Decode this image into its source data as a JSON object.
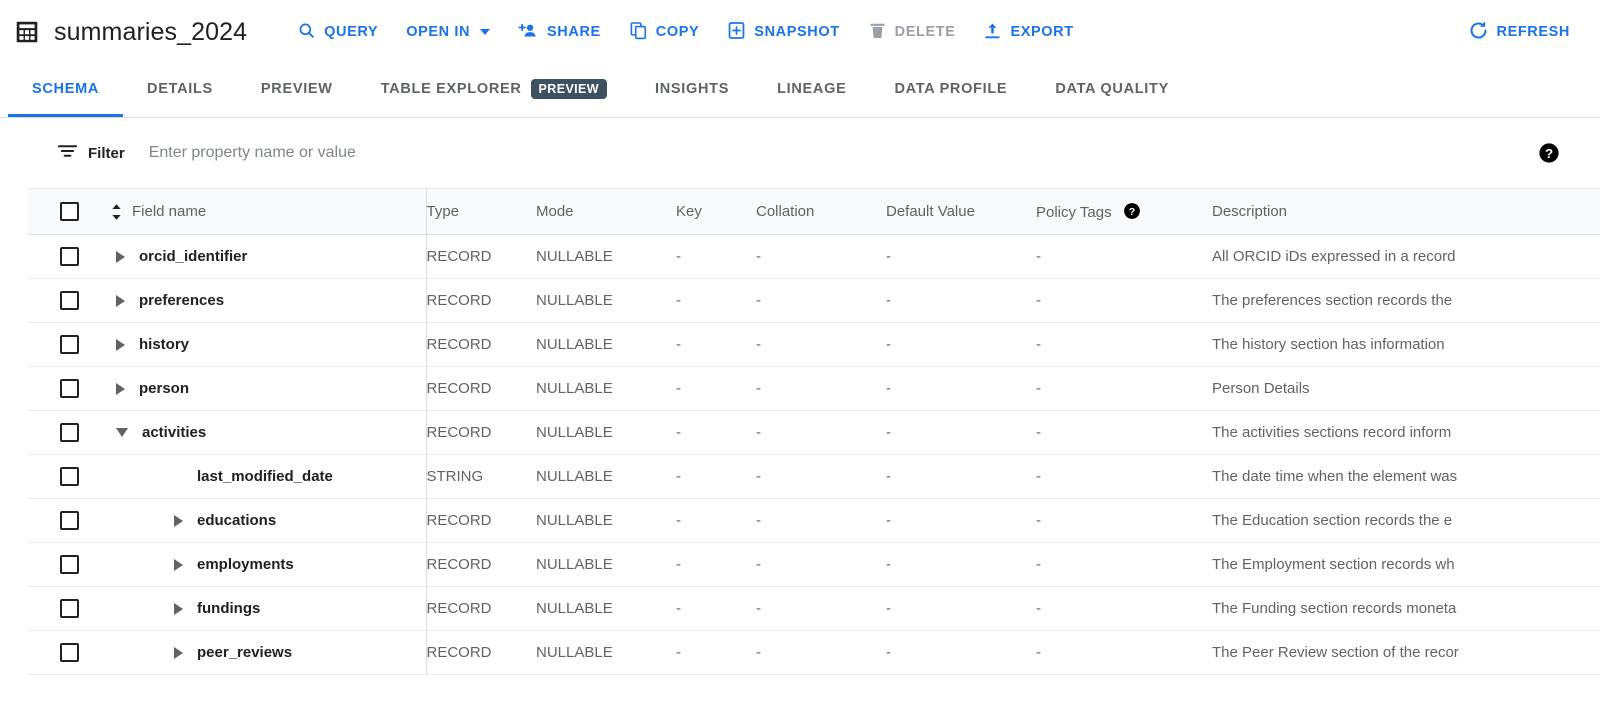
{
  "toolbar": {
    "table_icon": "table-grid-icon",
    "title": "summaries_2024",
    "actions": [
      {
        "label": "QUERY",
        "icon": "search-icon",
        "disabled": false,
        "dropdown": false
      },
      {
        "label": "OPEN IN",
        "icon": "none",
        "disabled": false,
        "dropdown": true
      },
      {
        "label": "SHARE",
        "icon": "person-add-icon",
        "disabled": false,
        "dropdown": false
      },
      {
        "label": "COPY",
        "icon": "copy-icon",
        "disabled": false,
        "dropdown": false
      },
      {
        "label": "SNAPSHOT",
        "icon": "snapshot-icon",
        "disabled": false,
        "dropdown": false
      },
      {
        "label": "DELETE",
        "icon": "trash-icon",
        "disabled": true,
        "dropdown": false
      },
      {
        "label": "EXPORT",
        "icon": "export-icon",
        "disabled": false,
        "dropdown": false
      }
    ],
    "refresh": {
      "label": "REFRESH",
      "icon": "refresh-icon"
    }
  },
  "tabs": [
    {
      "label": "SCHEMA",
      "active": true,
      "badge": ""
    },
    {
      "label": "DETAILS",
      "active": false,
      "badge": ""
    },
    {
      "label": "PREVIEW",
      "active": false,
      "badge": ""
    },
    {
      "label": "TABLE EXPLORER",
      "active": false,
      "badge": "PREVIEW"
    },
    {
      "label": "INSIGHTS",
      "active": false,
      "badge": ""
    },
    {
      "label": "LINEAGE",
      "active": false,
      "badge": ""
    },
    {
      "label": "DATA PROFILE",
      "active": false,
      "badge": ""
    },
    {
      "label": "DATA QUALITY",
      "active": false,
      "badge": ""
    }
  ],
  "filter": {
    "label": "Filter",
    "icon": "filter-icon",
    "value": "",
    "placeholder": "Enter property name or value",
    "help_icon": "help-circle-icon"
  },
  "table": {
    "columns": [
      "Field name",
      "Type",
      "Mode",
      "Key",
      "Collation",
      "Default Value",
      "Policy Tags",
      "Description"
    ],
    "policy_tags_help_icon": "help-circle-icon",
    "sort_icon": "sort-updown-icon",
    "select_all_checkbox": false,
    "rows": [
      {
        "name": "orcid_identifier",
        "indent": 0,
        "expander": "closed",
        "checked": false,
        "type": "RECORD",
        "mode": "NULLABLE",
        "key": "-",
        "collation": "-",
        "default_value": "-",
        "policy_tags": "-",
        "description": "All ORCID iDs expressed in a record"
      },
      {
        "name": "preferences",
        "indent": 0,
        "expander": "closed",
        "checked": false,
        "type": "RECORD",
        "mode": "NULLABLE",
        "key": "-",
        "collation": "-",
        "default_value": "-",
        "policy_tags": "-",
        "description": "The preferences section records the"
      },
      {
        "name": "history",
        "indent": 0,
        "expander": "closed",
        "checked": false,
        "type": "RECORD",
        "mode": "NULLABLE",
        "key": "-",
        "collation": "-",
        "default_value": "-",
        "policy_tags": "-",
        "description": "The history section has information"
      },
      {
        "name": "person",
        "indent": 0,
        "expander": "closed",
        "checked": false,
        "type": "RECORD",
        "mode": "NULLABLE",
        "key": "-",
        "collation": "-",
        "default_value": "-",
        "policy_tags": "-",
        "description": "Person Details"
      },
      {
        "name": "activities",
        "indent": 0,
        "expander": "open",
        "checked": false,
        "type": "RECORD",
        "mode": "NULLABLE",
        "key": "-",
        "collation": "-",
        "default_value": "-",
        "policy_tags": "-",
        "description": "The activities sections record inform"
      },
      {
        "name": "last_modified_date",
        "indent": 1,
        "expander": "none",
        "checked": false,
        "type": "STRING",
        "mode": "NULLABLE",
        "key": "-",
        "collation": "-",
        "default_value": "-",
        "policy_tags": "-",
        "description": "The date time when the element was"
      },
      {
        "name": "educations",
        "indent": 1,
        "expander": "closed",
        "checked": false,
        "type": "RECORD",
        "mode": "NULLABLE",
        "key": "-",
        "collation": "-",
        "default_value": "-",
        "policy_tags": "-",
        "description": "The Education section records the e"
      },
      {
        "name": "employments",
        "indent": 1,
        "expander": "closed",
        "checked": false,
        "type": "RECORD",
        "mode": "NULLABLE",
        "key": "-",
        "collation": "-",
        "default_value": "-",
        "policy_tags": "-",
        "description": "The Employment section records wh"
      },
      {
        "name": "fundings",
        "indent": 1,
        "expander": "closed",
        "checked": false,
        "type": "RECORD",
        "mode": "NULLABLE",
        "key": "-",
        "collation": "-",
        "default_value": "-",
        "policy_tags": "-",
        "description": "The Funding section records moneta"
      },
      {
        "name": "peer_reviews",
        "indent": 1,
        "expander": "closed",
        "checked": false,
        "type": "RECORD",
        "mode": "NULLABLE",
        "key": "-",
        "collation": "-",
        "default_value": "-",
        "policy_tags": "-",
        "description": "The Peer Review section of the recor"
      }
    ]
  },
  "colors": {
    "accent_blue": "#1a73e8",
    "text_primary": "#202124",
    "text_secondary": "#5f6368",
    "disabled": "#9aa0a6",
    "badge_bg": "#3c5260",
    "divider": "#dadce0",
    "header_bg": "#f8f9fa"
  }
}
